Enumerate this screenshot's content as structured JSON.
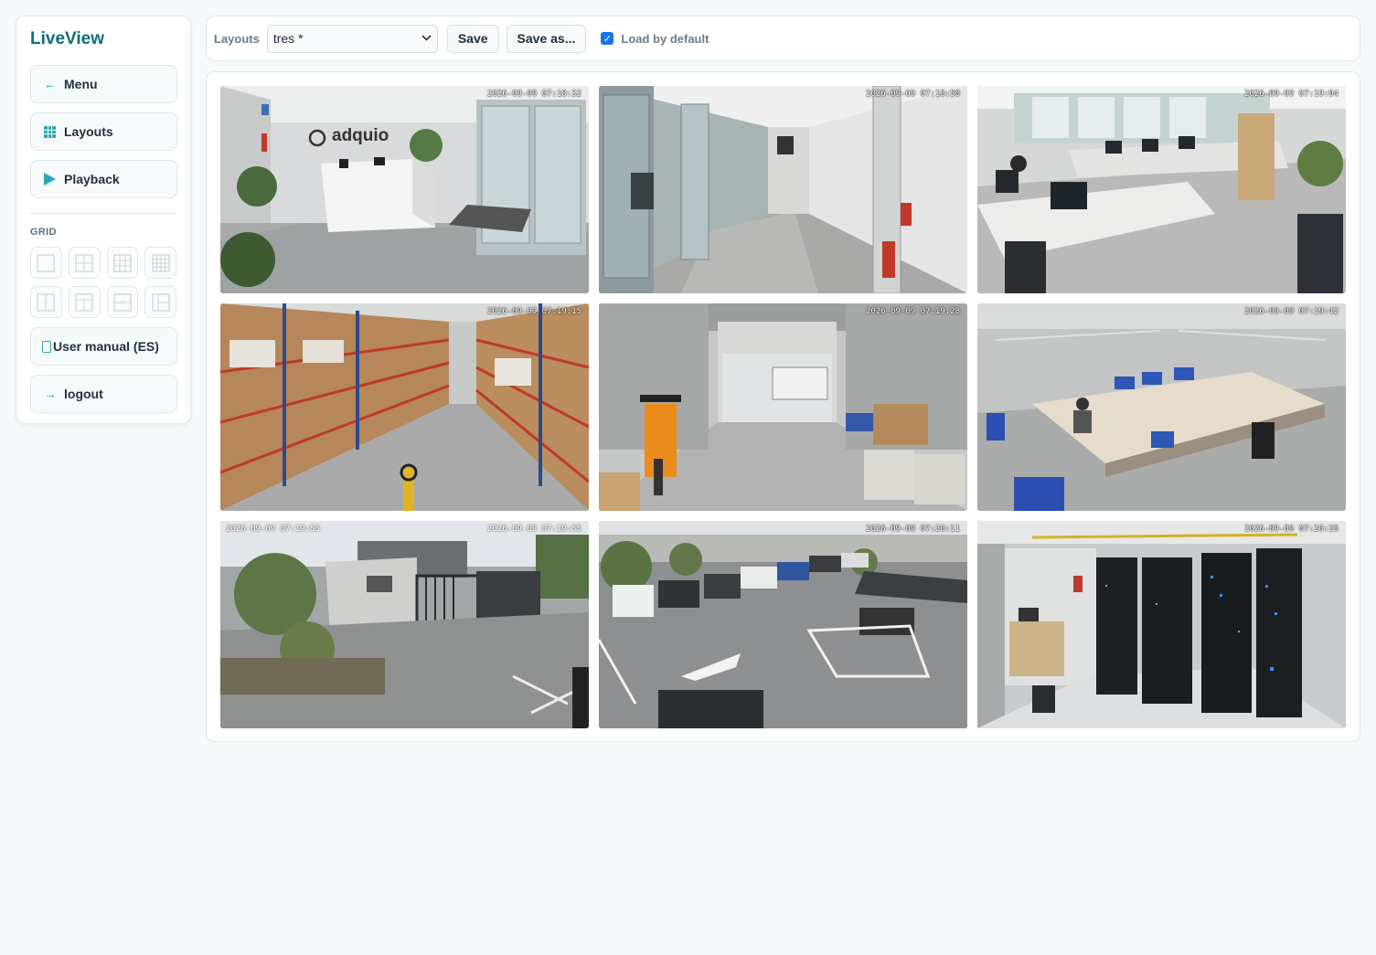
{
  "sidebar": {
    "brand": "LiveView",
    "menu_label": "Menu",
    "layouts_label": "Layouts",
    "playback_label": "Playback",
    "grid_heading": "GRID",
    "manual_label": "User manual (ES)",
    "logout_label": "logout"
  },
  "toolbar": {
    "layouts_label": "Layouts",
    "selected_layout": "tres *",
    "save_label": "Save",
    "save_as_label": "Save as...",
    "load_default_label": "Load by default",
    "load_default_checked": true
  },
  "cameras": [
    {
      "scene": "reception",
      "logo_text": "adquio",
      "timestamp": "2026-09-09 07:18:32"
    },
    {
      "scene": "corridor",
      "timestamp": "2026-09-09 07:18:50"
    },
    {
      "scene": "open office",
      "timestamp": "2026-09-09 07:19:04"
    },
    {
      "scene": "warehouse shelving",
      "timestamp": "2026-09-09 07:19:15"
    },
    {
      "scene": "loading dock with forklift",
      "timestamp": "2026-09-09 07:19:28"
    },
    {
      "scene": "workshop benches",
      "timestamp": "2026-09-09 07:19:42"
    },
    {
      "scene": "entrance gate",
      "timestamp": "2026-09-09 07:19:55",
      "timestamp_secondary": "2026-09-09 07:19:55"
    },
    {
      "scene": "parking lot",
      "timestamp": "2026-09-09 07:20:11"
    },
    {
      "scene": "server room",
      "timestamp": "2026-09-09 07:20:26"
    }
  ],
  "colors": {
    "brand": "#0f6d78",
    "accent": "#2aa7b6",
    "checkbox": "#1a73e8"
  },
  "icons": {
    "menu": "arrow-left-icon",
    "layouts": "grid-icon",
    "playback": "play-icon",
    "manual": "document-icon",
    "logout": "arrow-right-icon"
  }
}
